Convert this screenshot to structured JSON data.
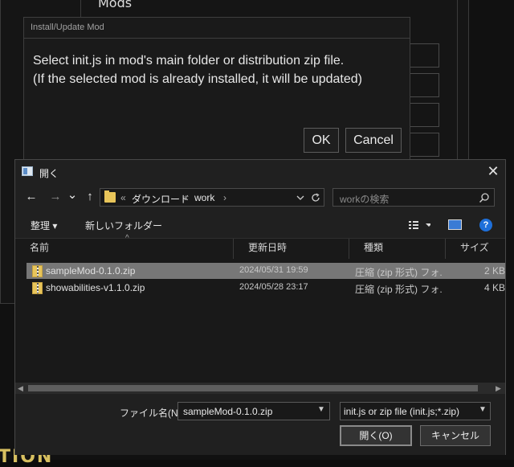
{
  "background_app": {
    "mods_label": "Mods",
    "logo_text": "TION"
  },
  "install_dialog": {
    "title": "Install/Update Mod",
    "message": "Select init.js in mod's main folder or distribution zip file.\n(If the selected mod is already installed, it will be updated)",
    "ok_label": "OK",
    "cancel_label": "Cancel"
  },
  "file_dialog": {
    "title": "開く",
    "close_glyph": "✕",
    "nav": {
      "back_glyph": "←",
      "forward_glyph": "→",
      "recent_glyph": "⌄",
      "up_glyph": "↑"
    },
    "address": {
      "overflow": "«",
      "segments": [
        "ダウンロード",
        "work"
      ],
      "separator": "›"
    },
    "search": {
      "placeholder": "workの検索"
    },
    "toolbar": {
      "organize_label": "整理 ▾",
      "new_folder_label": "新しいフォルダー",
      "help_label": "?"
    },
    "columns": [
      "名前",
      "更新日時",
      "種類",
      "サイズ"
    ],
    "files": [
      {
        "name": "sampleMod-0.1.0.zip",
        "modified": "2024/05/31 19:59",
        "type": "圧縮 (zip 形式) フォ...",
        "size": "2 KB",
        "selected": true
      },
      {
        "name": "showabilities-v1.1.0.zip",
        "modified": "2024/05/28 23:17",
        "type": "圧縮 (zip 形式) フォ...",
        "size": "4 KB",
        "selected": false
      }
    ],
    "filename_label": "ファイル名(N):",
    "filename_value": "sampleMod-0.1.0.zip",
    "filter_value": "init.js or zip file (init.js;*.zip)",
    "open_label": "開く(O)",
    "cancel_label": "キャンセル"
  },
  "colors": {
    "dialog_bg": "#202020",
    "selection": "#777777",
    "folder": "#e8c55a",
    "help_blue": "#1e6fd9"
  }
}
